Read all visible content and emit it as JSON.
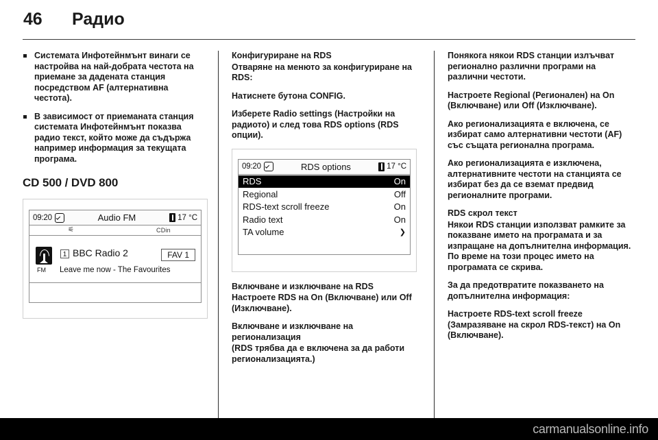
{
  "header": {
    "page_number": "46",
    "title": "Радио"
  },
  "footer": {
    "watermark": "carmanualsonline.info"
  },
  "left_column": {
    "bullets": [
      "Системата Инфотейнмънт винаги се настройва на най-добрата честота на приемане за дадената станция посредством AF (алтернативна честота).",
      "В зависимост от приеманата станция системата Инфотейнмънт показва радио текст, който може да съдържа например информация за текущата програма."
    ],
    "section_heading": "CD 500 / DVD 800",
    "screen": {
      "name": "audio-fm-screen",
      "clock": "09:20",
      "clock_icon": "clock-check-icon",
      "title": "Audio FM",
      "temperature": "17 °C",
      "temp_icon": "thermometer-icon",
      "bluetooth_icon": "bluetooth-icon",
      "aux_label": "CDin",
      "band_icon": "fm-antenna-icon",
      "band_label": "FM",
      "preset_number": "1",
      "station_name": "BBC Radio 2",
      "favourite_label": "FAV 1",
      "radio_text": "Leave me now - The Favourites"
    }
  },
  "middle_column": {
    "heading": "Конфигуриране на RDS",
    "intro": "Отваряне на менюто за конфигуриране на RDS:",
    "step_1": "Натиснете бутона CONFIG.",
    "step_2": "Изберете Radio settings (Настройки на радиото) и след това RDS options (RDS опции).",
    "screen": {
      "name": "rds-options-screen",
      "clock": "09:20",
      "clock_icon": "clock-check-icon",
      "title": "RDS options",
      "temperature": "17 °C",
      "temp_icon": "thermometer-icon",
      "rows": [
        {
          "label": "RDS",
          "value": "On",
          "selected": true,
          "arrow": false
        },
        {
          "label": "Regional",
          "value": "Off",
          "selected": false,
          "arrow": false
        },
        {
          "label": "RDS-text scroll freeze",
          "value": "On",
          "selected": false,
          "arrow": false
        },
        {
          "label": "Radio text",
          "value": "On",
          "selected": false,
          "arrow": false
        },
        {
          "label": "TA volume",
          "value": "",
          "selected": false,
          "arrow": true
        }
      ],
      "arrow_glyph": "❯"
    },
    "sub_heading_1": "Включване и изключване на RDS",
    "sub_text_1": "Настроете RDS на On (Включване) или Off (Изключване).",
    "sub_heading_2": "Включване и изключване на регионализация",
    "sub_text_2": "(RDS трябва да е включена за да работи регионализацията.)"
  },
  "right_column": {
    "para_1": "Понякога някои RDS станции излъчват регионално различни програми на различни честоти.",
    "para_2": "Настроете Regional (Регионален) на On (Включване) или Off (Изключване).",
    "para_3": "Ако регионализацията е включена, се избират само алтернативни честоти (AF) със същата регионална програма.",
    "para_4": "Ако регионализацията е изключена, алтернативните честоти на станцията се избират без да се вземат предвид регионалните програми.",
    "sub_heading": "RDS скрол текст",
    "para_5": "Някои RDS станции използват рамките за показване името на програмата и за изпращане на допълнителна информация. По време на този процес името на програмата се скрива.",
    "para_6": "За да предотвратите показването на допълнителна информация:",
    "para_7": "Настроете RDS-text scroll freeze (Замразяване на скрол RDS-текст) на On (Включване)."
  }
}
